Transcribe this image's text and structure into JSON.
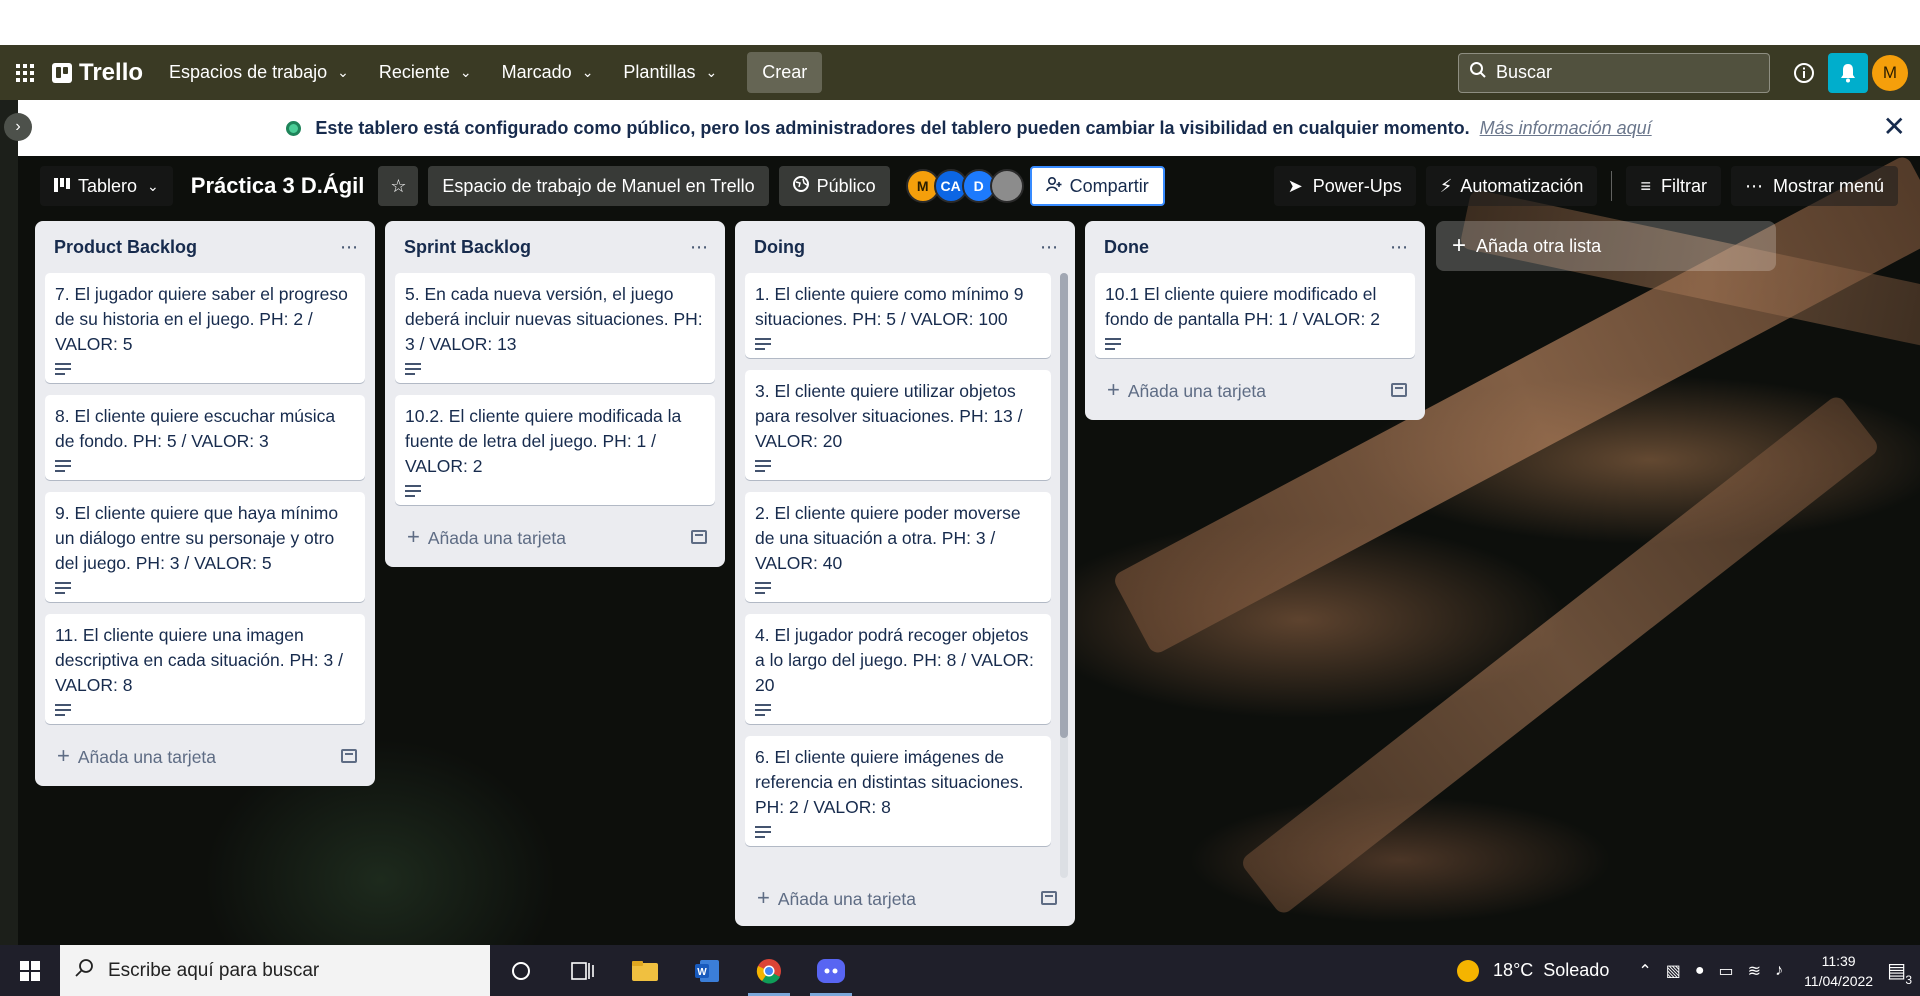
{
  "header": {
    "logo_text": "Trello",
    "nav": [
      "Espacios de trabajo",
      "Reciente",
      "Marcado",
      "Plantillas"
    ],
    "create_label": "Crear",
    "search_placeholder": "Buscar",
    "user_initial": "M"
  },
  "notice": {
    "text": "Este tablero está configurado como público, pero los administradores del tablero pueden cambiar la visibilidad en cualquier momento.",
    "link": "Más información aquí"
  },
  "board": {
    "view_label": "Tablero",
    "title": "Práctica 3 D.Ágil",
    "workspace_label": "Espacio de trabajo de Manuel en Trello",
    "visibility_label": "Público",
    "members": [
      {
        "initials": "M",
        "color": "#f59f0b"
      },
      {
        "initials": "CA",
        "color": "#0c66e4"
      },
      {
        "initials": "D",
        "color": "#1d7afc"
      },
      {
        "initials": "",
        "color": "#8c8c8c"
      }
    ],
    "share_label": "Compartir",
    "powerups_label": "Power-Ups",
    "automation_label": "Automatización",
    "filter_label": "Filtrar",
    "menu_label": "Mostrar menú"
  },
  "lists": [
    {
      "title": "Product Backlog",
      "cards": [
        "7. El jugador quiere saber el progreso de su historia en el juego. PH: 2 / VALOR: 5",
        "8. El cliente quiere escuchar música de fondo. PH: 5 / VALOR: 3",
        "9. El cliente quiere que haya mínimo un diálogo entre su personaje y otro del juego. PH: 3 / VALOR: 5",
        "11. El cliente quiere una imagen descriptiva en cada situación. PH: 3 / VALOR: 8"
      ]
    },
    {
      "title": "Sprint Backlog",
      "cards": [
        "5. En cada nueva versión, el juego deberá incluir nuevas situaciones. PH: 3 / VALOR: 13",
        "10.2. El cliente quiere modificada la fuente de letra del juego. PH: 1 / VALOR: 2"
      ]
    },
    {
      "title": "Doing",
      "cards": [
        "1. El cliente quiere como mínimo 9 situaciones. PH: 5 / VALOR: 100",
        "3. El cliente quiere utilizar objetos para resolver situaciones. PH: 13 / VALOR: 20",
        "2. El cliente quiere poder moverse de una situación a otra. PH: 3 / VALOR: 40",
        "4. El jugador podrá recoger objetos a lo largo del juego. PH: 8 / VALOR: 20",
        "6. El cliente quiere imágenes de referencia en distintas situaciones. PH: 2 / VALOR: 8"
      ]
    },
    {
      "title": "Done",
      "cards": [
        "10.1 El cliente quiere modificado el fondo de pantalla PH: 1 / VALOR: 2"
      ]
    }
  ],
  "add_card_label": "Añada una tarjeta",
  "add_list_label": "Añada otra lista",
  "taskbar": {
    "search_placeholder": "Escribe aquí para buscar",
    "weather": "18°C  Soleado",
    "time": "11:39",
    "date": "11/04/2022",
    "notification_count": "3"
  }
}
